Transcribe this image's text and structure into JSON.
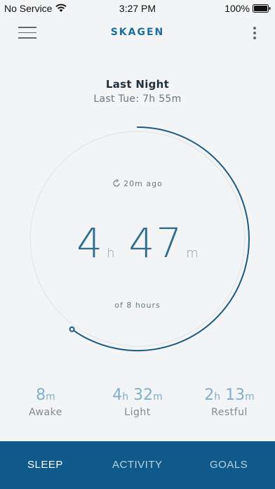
{
  "status": {
    "carrier": "No Service",
    "time": "3:27 PM",
    "battery": "100%"
  },
  "nav": {
    "brand": "SKAGEN"
  },
  "summary": {
    "title": "Last Night",
    "comparison": "Last Tue:  7h 55m",
    "synced": "20m ago",
    "hours": "4",
    "hours_unit": "h",
    "minutes": "47",
    "minutes_unit": "m",
    "goal": "of 8 hours",
    "progress_fraction": 0.6
  },
  "stats": [
    {
      "value": "8",
      "unit": "m",
      "label": "Awake"
    },
    {
      "value": "4",
      "unit": "h",
      "value2": "32",
      "unit2": "m",
      "label": "Light"
    },
    {
      "value": "2",
      "unit": "h",
      "value2": "13",
      "unit2": "m",
      "label": "Restful"
    }
  ],
  "tabs": [
    {
      "label": "SLEEP",
      "active": true
    },
    {
      "label": "ACTIVITY",
      "active": false
    },
    {
      "label": "GOALS",
      "active": false
    }
  ],
  "colors": {
    "accent": "#0f5a8a",
    "arc": "#1a5a84",
    "brand": "#1c6f9c"
  }
}
